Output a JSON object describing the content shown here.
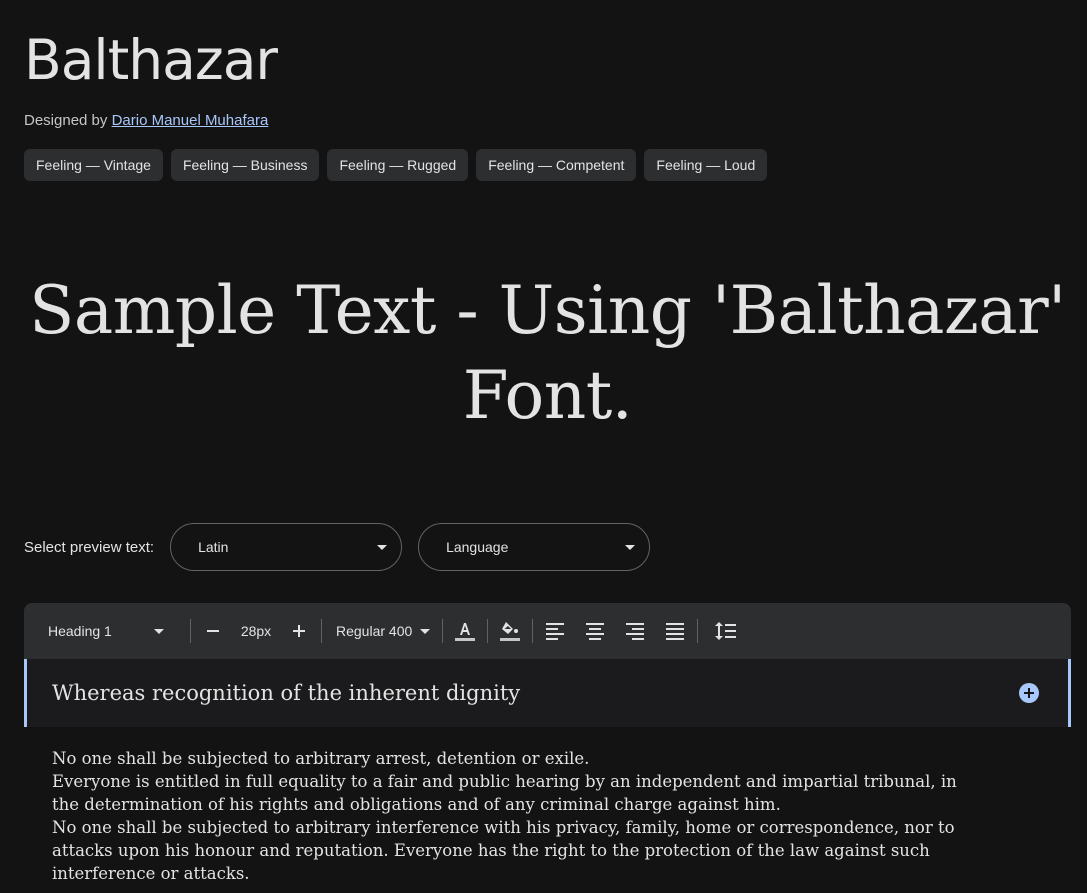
{
  "font": {
    "title": "Balthazar",
    "designed_by_prefix": "Designed by",
    "designer": "Dario Manuel Muhafara"
  },
  "tags": [
    "Feeling — Vintage",
    "Feeling — Business",
    "Feeling — Rugged",
    "Feeling — Competent",
    "Feeling — Loud"
  ],
  "sample": {
    "line1": "Sample Text - Using 'Balthazar'",
    "line2": "Font."
  },
  "preview": {
    "label": "Select preview text:",
    "script_value": "Latin",
    "language_value": "Language"
  },
  "toolbar": {
    "style_value": "Heading 1",
    "size_value": "28px",
    "weight_value": "Regular 400",
    "icons": [
      "minus-icon",
      "plus-icon",
      "text-color-icon",
      "highlight-color-icon",
      "align-left-icon",
      "align-center-icon",
      "align-right-icon",
      "align-justify-icon",
      "line-spacing-icon"
    ]
  },
  "editor": {
    "heading_text": "Whereas recognition of the inherent dignity",
    "accent_color": "#a8c7fa"
  },
  "body_paragraphs": [
    "No one shall be subjected to arbitrary arrest, detention or exile.",
    "Everyone is entitled in full equality to a fair and public hearing by an independent and impartial tribunal, in the determination of his rights and obligations and of any criminal charge against him.",
    "No one shall be subjected to arbitrary interference with his privacy, family, home or correspondence, nor to attacks upon his honour and reputation. Everyone has the right to the protection of the law against such interference or attacks."
  ]
}
